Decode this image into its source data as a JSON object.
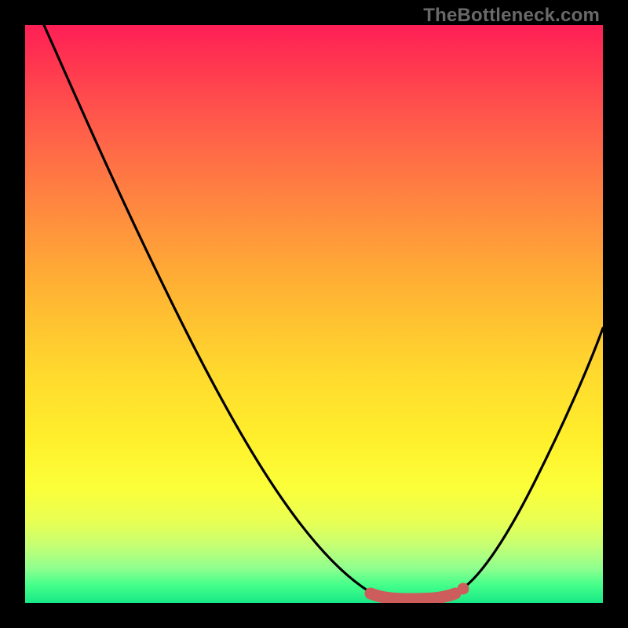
{
  "watermark": "TheBottleneck.com",
  "chart_data": {
    "type": "line",
    "title": "",
    "xlabel": "",
    "ylabel": "",
    "xlim": [
      0,
      100
    ],
    "ylim": [
      0,
      100
    ],
    "x": [
      0,
      5,
      10,
      15,
      20,
      25,
      30,
      35,
      40,
      45,
      50,
      55,
      60,
      62,
      64,
      66,
      68,
      70,
      72,
      74,
      76,
      80,
      85,
      90,
      95,
      100
    ],
    "values": [
      100,
      93,
      85,
      77,
      69,
      61,
      53,
      44,
      36,
      27,
      18,
      10,
      4,
      2,
      1,
      0,
      0,
      0,
      0,
      1,
      2,
      6,
      14,
      24,
      35,
      48
    ],
    "optimal_range": {
      "x_start": 62,
      "x_end": 76,
      "color": "#cd5c5c"
    },
    "background_gradient": {
      "top": "#ff1f57",
      "mid": "#ffd92e",
      "bottom": "#18e986"
    }
  }
}
